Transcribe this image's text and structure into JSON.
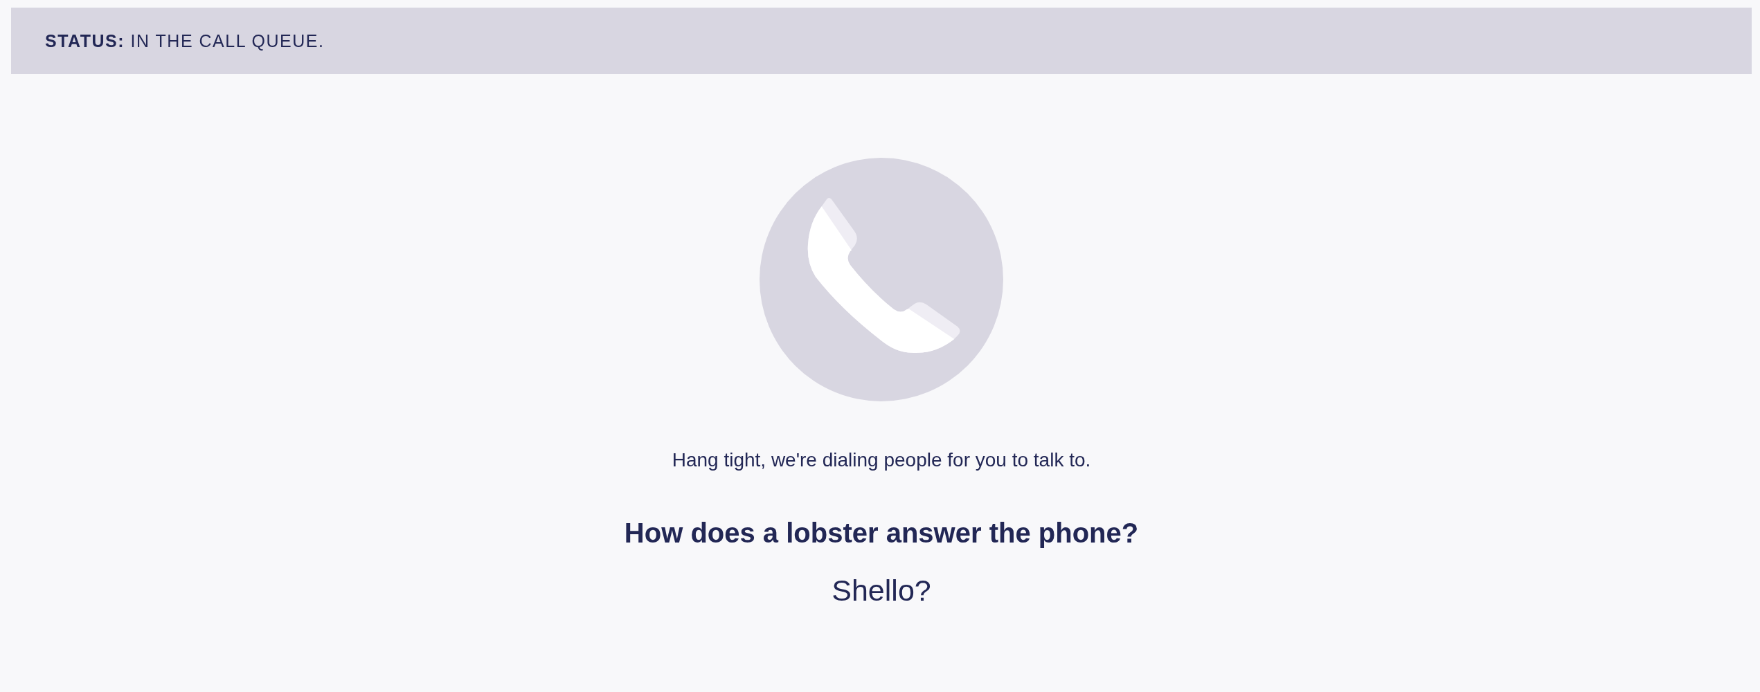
{
  "status_bar": {
    "text": "**STATUS:** IN THE CALL QUEUE."
  },
  "call_screen": {
    "message": "Hang tight, we're dialing people for you to talk to.",
    "joke": {
      "question": "How does a lobster answer the phone?",
      "answer": "Shello?"
    }
  }
}
